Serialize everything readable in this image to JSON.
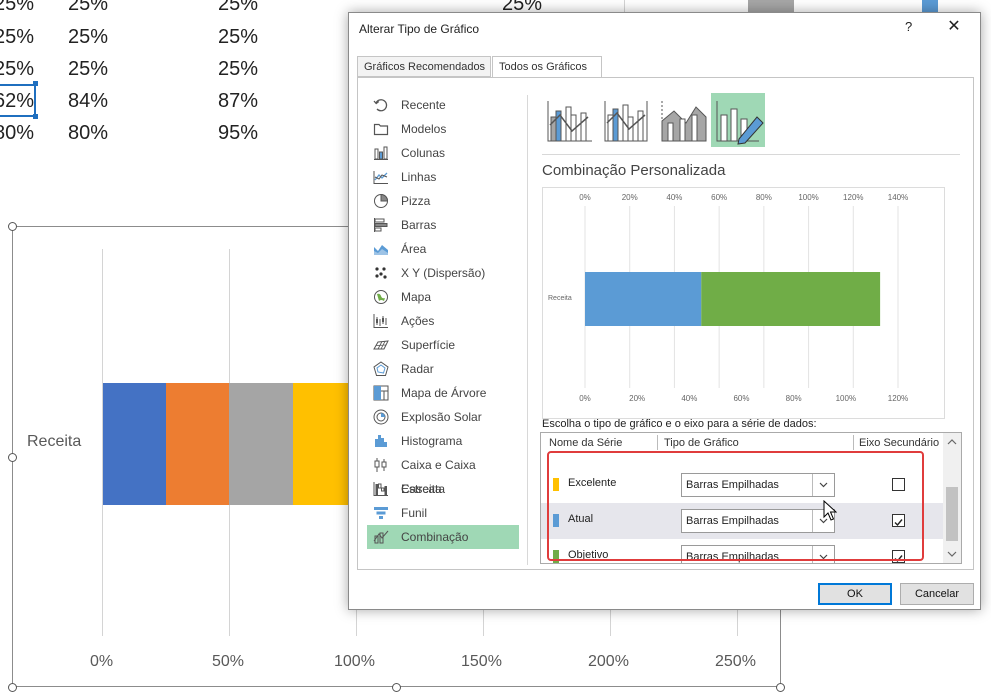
{
  "spreadsheet": {
    "rows": [
      {
        "c1": "25%",
        "c2": "25%",
        "c3": "25%",
        "c4": "25%"
      },
      {
        "c1": "25%",
        "c2": "25%",
        "c3": "25%"
      },
      {
        "c1": "25%",
        "c2": "25%",
        "c3": "25%"
      },
      {
        "c1": "62%",
        "c2": "84%",
        "c3": "87%"
      },
      {
        "c1": "80%",
        "c2": "80%",
        "c3": "95%"
      }
    ]
  },
  "background_chart": {
    "category": "Receita",
    "ticks": [
      "0%",
      "50%",
      "100%",
      "150%",
      "200%",
      "250%"
    ],
    "colors": {
      "s1": "#4472c4",
      "s2": "#ed7d31",
      "s3": "#a5a5a5",
      "s4": "#ffc000"
    }
  },
  "dialog": {
    "title": "Alterar Tipo de Gráfico",
    "help": "?",
    "close": "✕",
    "tabs": [
      "Gráficos Recomendados",
      "Todos os Gráficos"
    ],
    "chart_types": [
      {
        "label": "Recente",
        "icon": "recent-icon"
      },
      {
        "label": "Modelos",
        "icon": "templates-icon"
      },
      {
        "label": "Colunas",
        "icon": "column-chart-icon"
      },
      {
        "label": "Linhas",
        "icon": "line-chart-icon"
      },
      {
        "label": "Pizza",
        "icon": "pie-chart-icon"
      },
      {
        "label": "Barras",
        "icon": "bar-chart-icon"
      },
      {
        "label": "Área",
        "icon": "area-chart-icon"
      },
      {
        "label": "X Y (Dispersão)",
        "icon": "scatter-chart-icon"
      },
      {
        "label": "Mapa",
        "icon": "map-chart-icon"
      },
      {
        "label": "Ações",
        "icon": "stock-chart-icon"
      },
      {
        "label": "Superfície",
        "icon": "surface-chart-icon"
      },
      {
        "label": "Radar",
        "icon": "radar-chart-icon"
      },
      {
        "label": "Mapa de Árvore",
        "icon": "treemap-chart-icon"
      },
      {
        "label": "Explosão Solar",
        "icon": "sunburst-chart-icon"
      },
      {
        "label": "Histograma",
        "icon": "histogram-chart-icon"
      },
      {
        "label": "Caixa e Caixa Estreita",
        "icon": "box-whisker-chart-icon"
      },
      {
        "label": "Cascata",
        "icon": "waterfall-chart-icon"
      },
      {
        "label": "Funil",
        "icon": "funnel-chart-icon"
      },
      {
        "label": "Combinação",
        "icon": "combo-chart-icon"
      }
    ],
    "selected_type": "Combinação",
    "combo_title": "Combinação Personalizada",
    "series_prompt": "Escolha o tipo de gráfico e o eixo para a série de dados:",
    "columns": {
      "name": "Nome da Série",
      "type": "Tipo de Gráfico",
      "secondary": "Eixo Secundário"
    },
    "series": [
      {
        "name": "Excelente",
        "color": "#ffc000",
        "type": "Barras Empilhadas",
        "secondary": false
      },
      {
        "name": "Atual",
        "color": "#5b9bd5",
        "type": "Barras Empilhadas",
        "secondary": true
      },
      {
        "name": "Objetivo",
        "color": "#70ad47",
        "type": "Barras Empilhadas",
        "secondary": true
      }
    ],
    "ok": "OK",
    "cancel": "Cancelar"
  },
  "chart_data": {
    "type": "bar",
    "categories": [
      "Receita"
    ],
    "series": [
      {
        "name": "Atual",
        "values": [
          0.52
        ]
      },
      {
        "name": "Objetivo",
        "values": [
          0.8
        ]
      }
    ],
    "top_axis_ticks": [
      "0%",
      "20%",
      "40%",
      "60%",
      "80%",
      "100%",
      "120%",
      "140%"
    ],
    "bottom_axis_ticks": [
      "0%",
      "20%",
      "40%",
      "60%",
      "80%",
      "100%",
      "120%"
    ],
    "xlim_top": [
      0,
      1.4
    ],
    "xlim_bottom": [
      0,
      1.2
    ],
    "grid": true,
    "colors": {
      "Atual": "#5b9bd5",
      "Objetivo": "#70ad47"
    }
  }
}
